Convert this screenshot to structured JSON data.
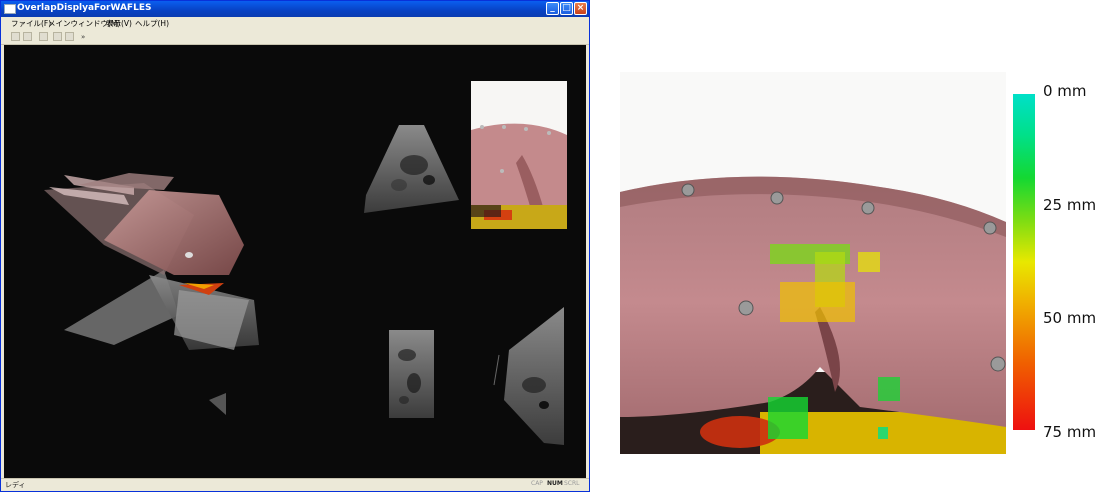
{
  "window": {
    "title": "OverlapDisplyaForWAFLES",
    "buttons": {
      "minimize": "_",
      "maximize": "□",
      "close": "×"
    }
  },
  "menu": [
    {
      "label": "ファイル(F)"
    },
    {
      "label": "メインウィンドウ(M)"
    },
    {
      "label": "表示(V)"
    },
    {
      "label": "ヘルプ(H)"
    }
  ],
  "toolbar": {
    "grip_label": "»"
  },
  "status": {
    "text": "レディ",
    "indicators": [
      {
        "label": "CAP",
        "active": false
      },
      {
        "label": "NUM",
        "active": true
      },
      {
        "label": "SCRL",
        "active": false
      }
    ]
  },
  "colorbar": {
    "labels": [
      "0 mm",
      "25 mm",
      "50 mm",
      "75 mm"
    ],
    "colors": {
      "top": "#00e0c8",
      "mid": "#e8e800",
      "bottom": "#ee1010"
    }
  }
}
